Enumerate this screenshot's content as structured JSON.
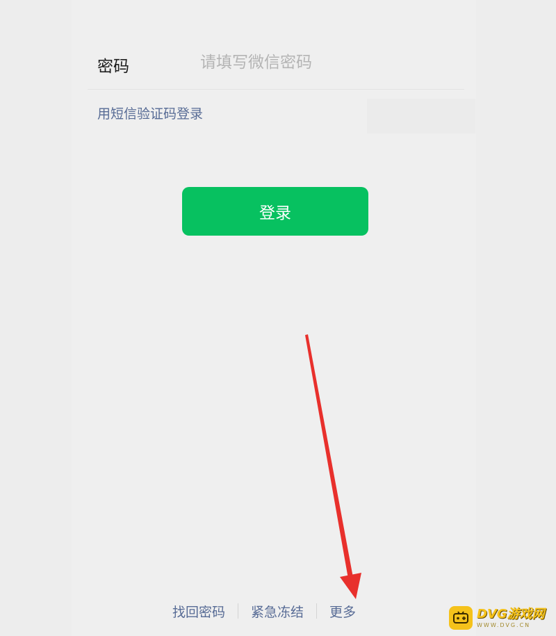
{
  "login_form": {
    "password_label": "密码",
    "password_placeholder": "请填写微信密码",
    "password_value": "",
    "sms_login_link": "用短信验证码登录",
    "login_button": "登录"
  },
  "footer": {
    "links": [
      {
        "label": "找回密码"
      },
      {
        "label": "紧急冻结"
      },
      {
        "label": "更多"
      }
    ]
  },
  "annotation": {
    "arrow_color": "#e8302c",
    "points_to": "更多"
  },
  "watermark": {
    "brand": "DVG游戏网",
    "url": "WWW.DVG.CN",
    "color": "#f5c21b"
  },
  "colors": {
    "accent_green": "#07c160",
    "link_blue": "#576b95",
    "background": "#ededed"
  }
}
